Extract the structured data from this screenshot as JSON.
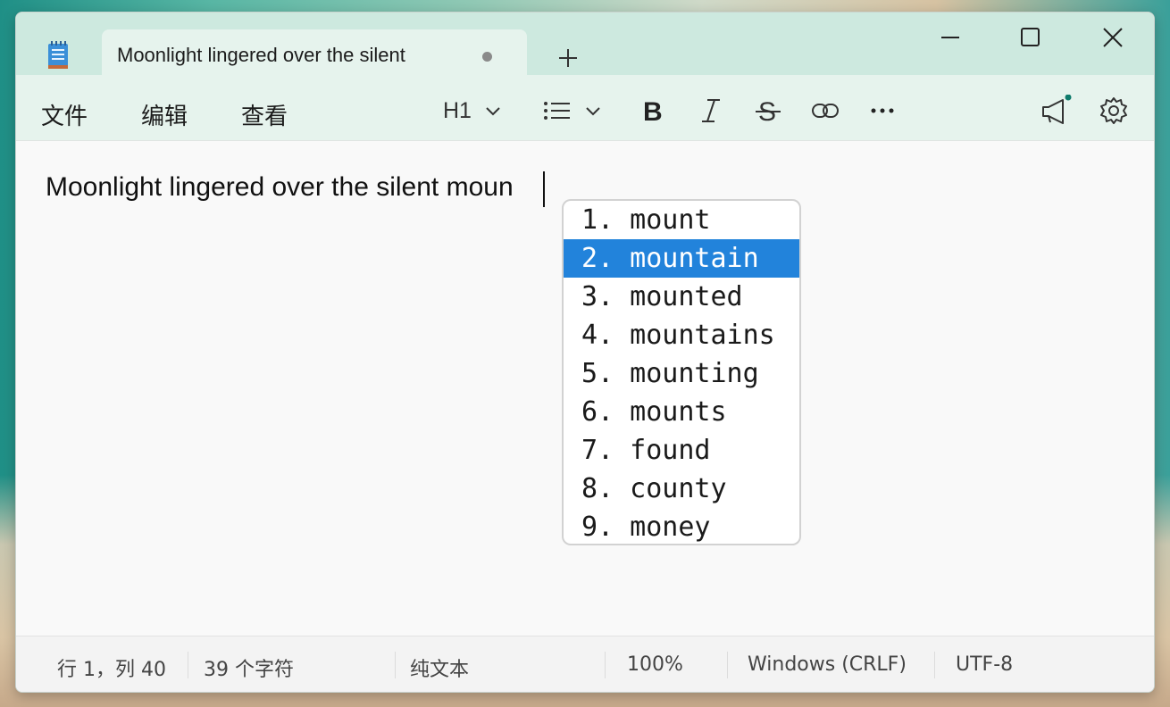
{
  "window": {
    "tab_title": "Moonlight lingered over the silent",
    "tab_modified_indicator": "•",
    "new_tab_icon": "plus-icon",
    "controls": [
      "minimize-icon",
      "maximize-icon",
      "close-icon"
    ]
  },
  "menu": {
    "file": "文件",
    "edit": "编辑",
    "view": "查看"
  },
  "toolbar": {
    "heading_label": "H1",
    "icons": [
      "chevron-down-icon",
      "list-icon",
      "bold-icon",
      "italic-icon",
      "strikethrough-icon",
      "link-icon",
      "more-icon",
      "megaphone-icon",
      "gear-icon"
    ]
  },
  "editor": {
    "text": "Moonlight lingered over the silent moun"
  },
  "autocomplete": {
    "selected_index": 1,
    "items": [
      "1. mount",
      "2. mountain",
      "3. mounted",
      "4. mountains",
      "5. mounting",
      "6. mounts",
      "7. found",
      "8. county",
      "9. money"
    ]
  },
  "status": {
    "position": "行 1，列 40",
    "chars": "39 个字符",
    "format": "纯文本",
    "zoom": "100%",
    "line_ending": "Windows (CRLF)",
    "encoding": "UTF-8"
  },
  "colors": {
    "accent": "#2283db",
    "titlebar": "#cde9df",
    "notification_dot": "#0f7b6c"
  }
}
